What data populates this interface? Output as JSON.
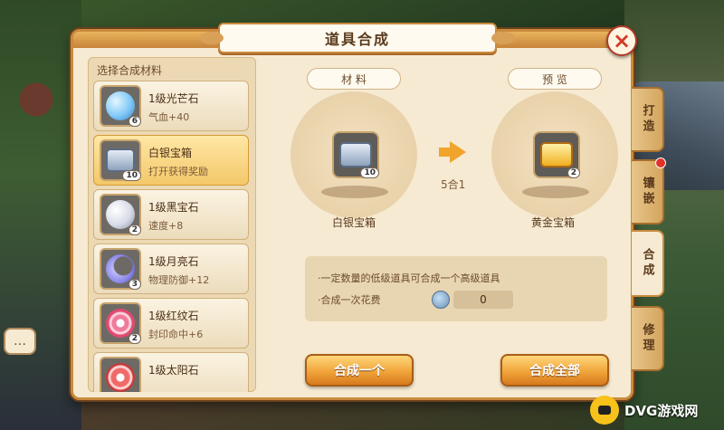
{
  "dialog": {
    "title": "道具合成",
    "close_label": "×"
  },
  "left_panel": {
    "title": "选择合成材料",
    "items": [
      {
        "name": "1级光芒石",
        "desc": "气血+40",
        "qty": "6",
        "gem_color": "#7fc8f8",
        "selected": false
      },
      {
        "name": "白银宝箱",
        "desc": "打开获得奖励",
        "qty": "10",
        "gem_color": "#9fb0c8",
        "selected": true
      },
      {
        "name": "1级黑宝石",
        "desc": "速度+8",
        "qty": "2",
        "gem_color": "#d8dce8",
        "selected": false
      },
      {
        "name": "1级月亮石",
        "desc": "物理防御+12",
        "qty": "3",
        "gem_color": "#8a86e8",
        "selected": false
      },
      {
        "name": "1级红纹石",
        "desc": "封印命中+6",
        "qty": "2",
        "gem_color": "#f07a9a",
        "selected": false
      },
      {
        "name": "1级太阳石",
        "desc": "",
        "qty": "",
        "gem_color": "#f06a6a",
        "selected": false
      }
    ]
  },
  "center": {
    "material_tag": "材 料",
    "preview_tag": "预 览",
    "material_name": "白银宝箱",
    "material_qty": "10",
    "ratio": "5合1",
    "result_name": "黄金宝箱",
    "result_qty": "2",
    "info_line1": "·一定数量的低级道具可合成一个高级道具",
    "info_line2": "·合成一次花费",
    "cost": "0"
  },
  "buttons": {
    "synth_one": "合成一个",
    "synth_all": "合成全部"
  },
  "side_tabs": [
    {
      "label": "打造",
      "active": false,
      "dot": false
    },
    {
      "label": "镶嵌",
      "active": false,
      "dot": true
    },
    {
      "label": "合成",
      "active": true,
      "dot": false
    },
    {
      "label": "修理",
      "active": false,
      "dot": false
    }
  ],
  "watermark": {
    "text": "DVG游戏网"
  },
  "colors": {
    "accent": "#f0a43a",
    "panel": "#f6ead2",
    "border": "#c98a3c"
  }
}
